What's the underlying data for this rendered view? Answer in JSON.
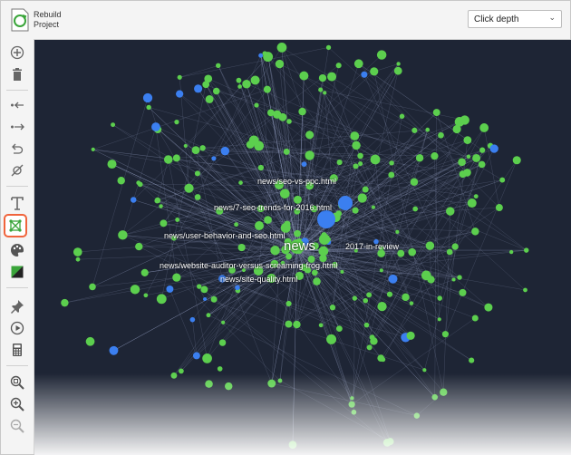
{
  "toolbar": {
    "rebuild_label": "Rebuild Project",
    "depth_select": {
      "value": "Click depth"
    }
  },
  "sidebar": {
    "items": [
      {
        "icon": "add-icon"
      },
      {
        "icon": "trash-icon"
      },
      {
        "icon": "arrow-in-icon"
      },
      {
        "icon": "arrow-out-icon"
      },
      {
        "icon": "undo-icon"
      },
      {
        "icon": "eye-off-icon"
      },
      {
        "icon": "text-icon"
      },
      {
        "icon": "graph-layout-icon",
        "active": true
      },
      {
        "icon": "palette-icon"
      },
      {
        "icon": "contrast-icon"
      },
      {
        "icon": "pin-icon"
      },
      {
        "icon": "play-icon"
      },
      {
        "icon": "calculator-icon"
      },
      {
        "icon": "zoom-fit-icon"
      },
      {
        "icon": "zoom-in-icon"
      },
      {
        "icon": "zoom-out-icon"
      }
    ]
  },
  "graph": {
    "center_label": "news",
    "labels": [
      "news/seo-vs-ppc.html",
      "news/7-seo-trends-for-2016.html",
      "news/user-behavior-and-seo.html",
      "2017-in-review",
      "news/website-auditor-versus-screaming-frog.html",
      "news/site-quality.html"
    ],
    "colors": {
      "background": "#1e2535",
      "node_green": "#5ccf4e",
      "node_blue": "#3b7ff0",
      "edge": "#9aa6c8"
    }
  }
}
